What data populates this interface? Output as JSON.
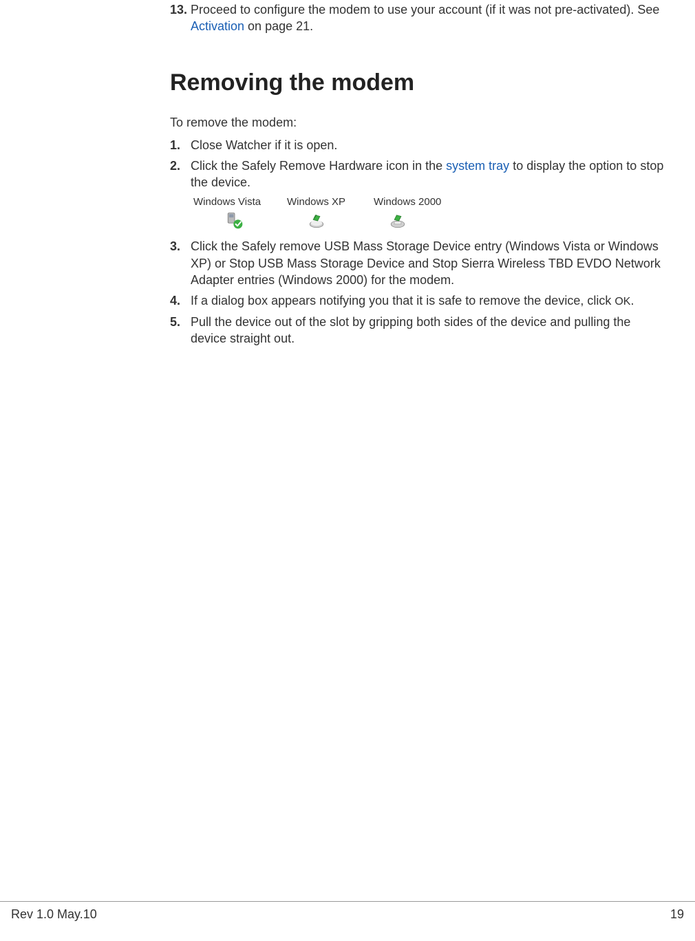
{
  "content": {
    "step13": {
      "num": "13.",
      "text_pre": "Proceed to configure the modem to use your account (if it was not pre-activated). See ",
      "link": "Activation",
      "text_post": " on page 21."
    },
    "heading": "Removing the modem",
    "intro": "To remove the modem:",
    "steps": [
      {
        "num": "1.",
        "text": "Close Watcher if it is open."
      },
      {
        "num": "2.",
        "text_pre": "Click the Safely Remove Hardware icon in the ",
        "link": "system tray",
        "text_post": " to display the option to stop the device."
      },
      {
        "num": "3.",
        "text": "Click the Safely remove USB Mass Storage Device entry (Windows Vista or Windows XP) or Stop USB Mass Storage Device and Stop Sierra Wireless TBD EVDO Network Adapter entries (Windows 2000) for the modem."
      },
      {
        "num": "4.",
        "text_pre": "If a dialog box appears notifying you that it is safe to remove the device, click ",
        "ok": "OK",
        "text_post": "."
      },
      {
        "num": "5.",
        "text": "Pull the device out of the slot by gripping both sides of the  device and pulling the device straight out."
      }
    ],
    "icons": {
      "headers": [
        "Windows Vista",
        "Windows XP",
        "Windows 2000"
      ]
    }
  },
  "footer": {
    "left": "Rev 1.0  May.10",
    "right": "19"
  }
}
